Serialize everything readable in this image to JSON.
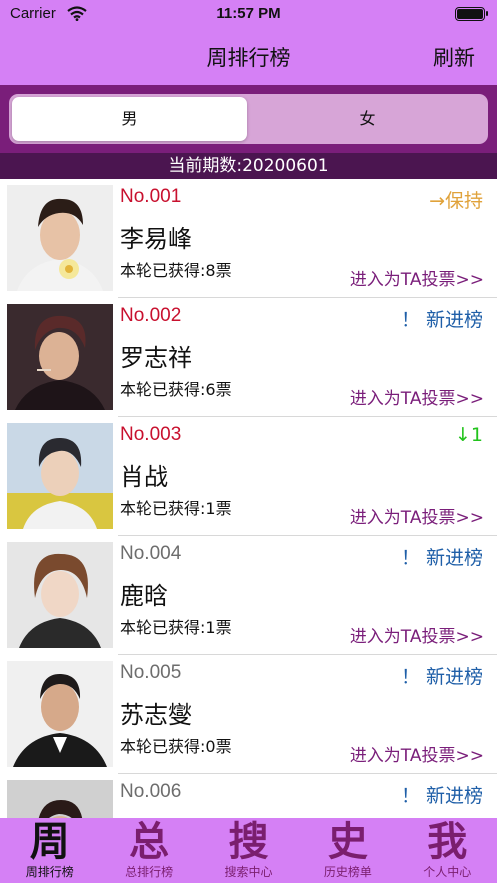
{
  "status_bar": {
    "carrier": "Carrier",
    "time": "11:57 PM"
  },
  "nav": {
    "title": "周排行榜",
    "refresh_label": "刷新"
  },
  "segment": {
    "male_label": "男",
    "female_label": "女",
    "selected": "male"
  },
  "period": {
    "text": "当前期数:20200601"
  },
  "ranking": [
    {
      "rank": "No.001",
      "name": "李易峰",
      "votes": "本轮已获得:8票",
      "status": "→保持",
      "status_type": "keep",
      "link": "进入为TA投票>>"
    },
    {
      "rank": "No.002",
      "name": "罗志祥",
      "votes": "本轮已获得:6票",
      "status": "！ 新进榜",
      "status_type": "new",
      "link": "进入为TA投票>>"
    },
    {
      "rank": "No.003",
      "name": "肖战",
      "votes": "本轮已获得:1票",
      "status": "↓1",
      "status_type": "down",
      "link": "进入为TA投票>>"
    },
    {
      "rank": "No.004",
      "name": "鹿晗",
      "votes": "本轮已获得:1票",
      "status": "！ 新进榜",
      "status_type": "new",
      "link": "进入为TA投票>>"
    },
    {
      "rank": "No.005",
      "name": "苏志燮",
      "votes": "本轮已获得:0票",
      "status": "！ 新进榜",
      "status_type": "new",
      "link": "进入为TA投票>>"
    },
    {
      "rank": "No.006",
      "name": "",
      "votes": "",
      "status": "！ 新进榜",
      "status_type": "new",
      "link": ""
    }
  ],
  "tabs": [
    {
      "glyph": "周",
      "label": "周排行榜"
    },
    {
      "glyph": "总",
      "label": "总排行榜"
    },
    {
      "glyph": "搜",
      "label": "搜索中心"
    },
    {
      "glyph": "史",
      "label": "历史榜单"
    },
    {
      "glyph": "我",
      "label": "个人中心"
    }
  ],
  "colors": {
    "bar_purple": "#d580f5",
    "dark_purple": "#7a1e7a",
    "rank_red": "#c8102e",
    "status_keep": "#e0a23a",
    "status_new": "#1f5fa8",
    "status_down": "#22c31c"
  }
}
